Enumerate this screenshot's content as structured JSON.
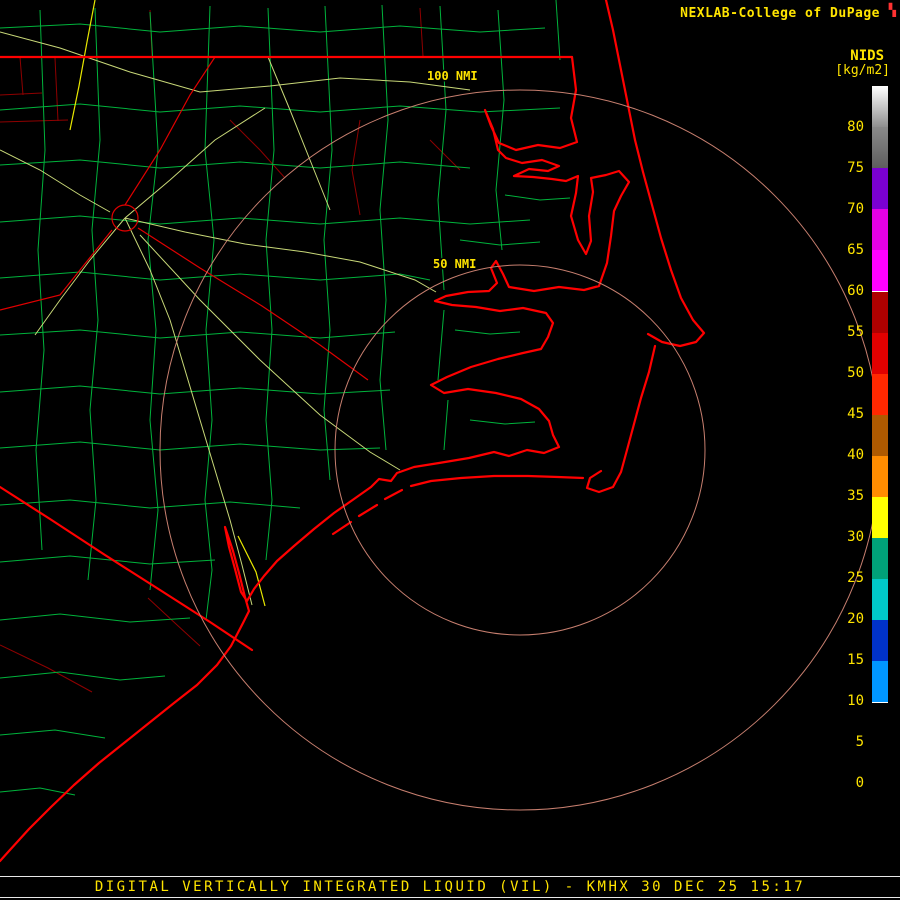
{
  "header": {
    "brand": "NEXLAB-College of DuPage",
    "logo_glyph": "▚",
    "product_label": "NIDS",
    "units_label": "[kg/m2]"
  },
  "map": {
    "radar_site": "KMHX",
    "outer_ring_label": "100 NMI",
    "inner_ring_label": "50 NMI",
    "colors": {
      "coastline": "#FF0000",
      "county_lines": "#00B33C",
      "roads": "#C8D878",
      "range_rings": "#C77F6F",
      "labels": "#FFE400"
    }
  },
  "colorbar": {
    "rows": [
      {
        "label": "80",
        "color": "grad:#FFFFFF,#909090"
      },
      {
        "label": "75",
        "color": "grad:#8A8A8A,#5E5E5E"
      },
      {
        "label": "70",
        "color": "#7A00D2"
      },
      {
        "label": "65",
        "color": "#E400E4"
      },
      {
        "label": "60",
        "color": "#FF00FF"
      },
      {
        "label": "55",
        "color": "#AF0000",
        "divider_top": true
      },
      {
        "label": "50",
        "color": "#E10000"
      },
      {
        "label": "45",
        "color": "#FF2800"
      },
      {
        "label": "40",
        "color": "#AF5A00"
      },
      {
        "label": "35",
        "color": "#FF8C00"
      },
      {
        "label": "30",
        "color": "#FFFF00"
      },
      {
        "label": "25",
        "color": "#00A078"
      },
      {
        "label": "20",
        "color": "#00C8C8"
      },
      {
        "label": "15",
        "color": "#0032C8"
      },
      {
        "label": "10",
        "color": "#0096FF"
      },
      {
        "label": "5",
        "color": "#000000",
        "divider_top": true
      },
      {
        "label": "0",
        "color": "#000000"
      },
      {
        "label": "",
        "color": "#000000"
      }
    ]
  },
  "footer": {
    "title": "DIGITAL VERTICALLY INTEGRATED LIQUID (VIL) - KMHX 30 DEC 25 15:17"
  }
}
